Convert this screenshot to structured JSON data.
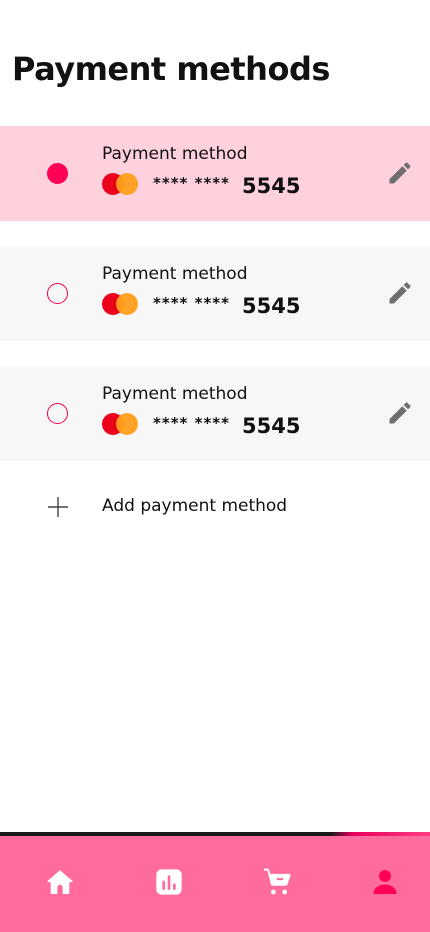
{
  "header": {
    "title": "Payment methods"
  },
  "payment_methods": [
    {
      "label": "Payment method",
      "mask": "**** ****",
      "last4": "5545",
      "selected": true
    },
    {
      "label": "Payment method",
      "mask": "**** ****",
      "last4": "5545",
      "selected": false
    },
    {
      "label": "Payment method",
      "mask": "**** ****",
      "last4": "5545",
      "selected": false
    }
  ],
  "add_method": {
    "label": "Add payment method",
    "icon": "plus-icon"
  },
  "card_brand": "mastercard",
  "colors": {
    "accent": "#ff0055",
    "selected_row": "#ffd1dd",
    "row": "#f7f7f7",
    "nav_bar": "#ff6b9d",
    "mastercard_red": "#eb001b",
    "mastercard_orange": "#ff9f1a"
  },
  "bottom_nav": [
    {
      "name": "home",
      "icon": "home-icon",
      "active": false
    },
    {
      "name": "stats",
      "icon": "bar-chart-icon",
      "active": false
    },
    {
      "name": "cart",
      "icon": "cart-icon",
      "active": false
    },
    {
      "name": "profile",
      "icon": "user-icon",
      "active": true
    }
  ]
}
